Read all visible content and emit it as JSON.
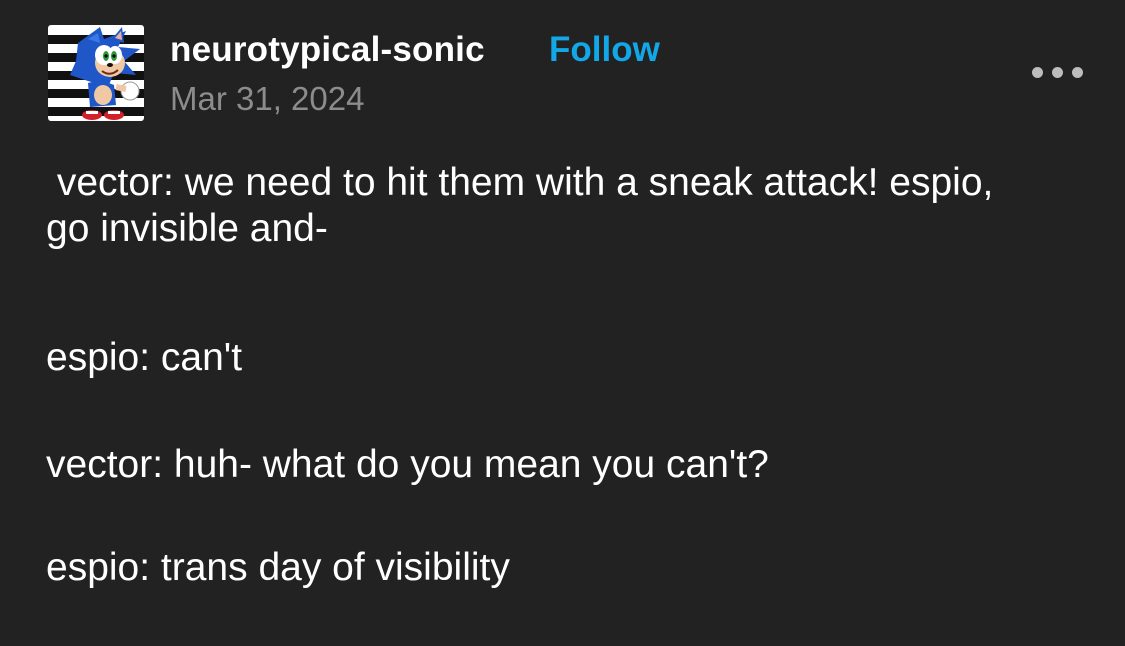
{
  "post": {
    "author": "neurotypical-sonic",
    "follow_label": "Follow",
    "date": "Mar 31, 2024",
    "avatar_icon": "sonic-avatar-icon",
    "more_icon": "more-options-icon",
    "paragraphs": [
      " vector: we need to hit them with a sneak attack! espio, go invisible and-",
      "espio: can't",
      "vector: huh- what do you mean you can't?",
      "espio: trans day of visibility"
    ]
  },
  "colors": {
    "background": "#222222",
    "follow": "#12a8e8",
    "date": "#8c8c8c",
    "text": "#ffffff"
  }
}
